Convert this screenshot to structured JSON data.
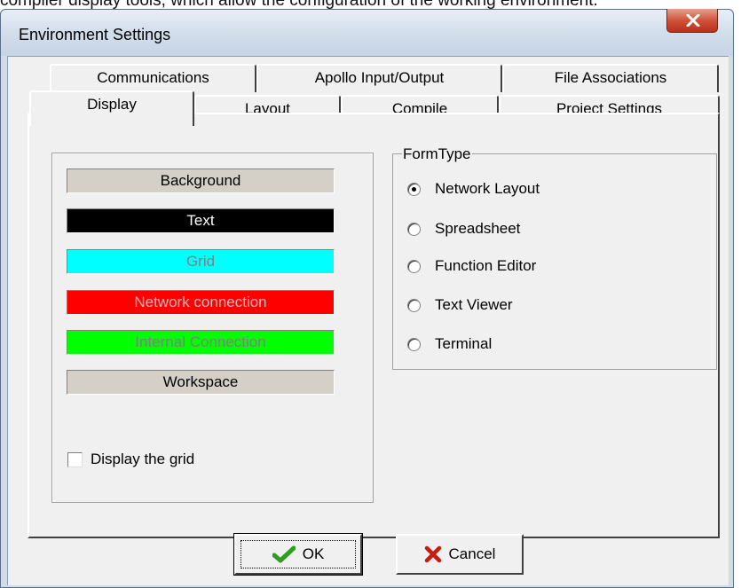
{
  "behind_window_text": "compiler display tools, which allow the configuration of the working environment.",
  "window": {
    "title": "Environment Settings"
  },
  "tabs_row_back": [
    {
      "label": "Communications"
    },
    {
      "label": "Apollo Input/Output"
    },
    {
      "label": "File Associations"
    }
  ],
  "tabs_row_front": [
    {
      "label": "Display",
      "active": true
    },
    {
      "label": "Layout"
    },
    {
      "label": "Compile"
    },
    {
      "label": "Project Settings"
    }
  ],
  "colors": {
    "items": [
      {
        "label": "Background",
        "bg": "#d4d0c8",
        "fg": "#000000"
      },
      {
        "label": "Text",
        "bg": "#000000",
        "fg": "#ffffff"
      },
      {
        "label": "Grid",
        "bg": "#00ffff",
        "fg": "#808080"
      },
      {
        "label": "Network connection",
        "bg": "#ff0000",
        "fg": "#c0c0c0"
      },
      {
        "label": "Internal Connection",
        "bg": "#00ff00",
        "fg": "#808080"
      },
      {
        "label": "Workspace",
        "bg": "#d4d0c8",
        "fg": "#000000"
      }
    ]
  },
  "display_grid": {
    "label": "Display the grid",
    "checked": false
  },
  "formtype": {
    "legend": "FormType",
    "options": [
      {
        "label": "Network Layout",
        "checked": true
      },
      {
        "label": "Spreadsheet",
        "checked": false
      },
      {
        "label": "Function Editor",
        "checked": false
      },
      {
        "label": "Text Viewer",
        "checked": false
      },
      {
        "label": "Terminal",
        "checked": false
      }
    ]
  },
  "buttons": {
    "ok": "OK",
    "cancel": "Cancel"
  },
  "icons": {
    "ok": "green-check-icon",
    "cancel": "red-x-icon",
    "close": "close-icon"
  }
}
